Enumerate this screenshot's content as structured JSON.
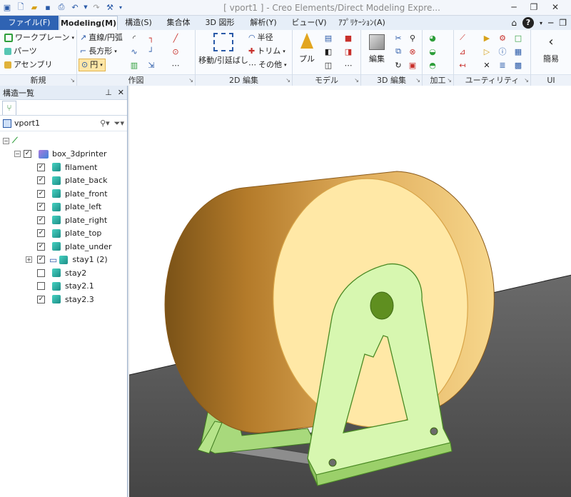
{
  "window": {
    "title": "[ vport1 ] - Creo Elements/Direct Modeling Expre..."
  },
  "tabs": [
    {
      "label": "ファイル(F)"
    },
    {
      "label": "Modeling(M)"
    },
    {
      "label": "構造(S)"
    },
    {
      "label": "集合体"
    },
    {
      "label": "3D 図形"
    },
    {
      "label": "解析(Y)"
    },
    {
      "label": "ビュー(V)"
    },
    {
      "label": "ｱﾌﾟﾘｹｰｼｮﾝ(A)"
    }
  ],
  "ribbon": {
    "new_group": {
      "label": "新規",
      "items": [
        "ワークプレーン",
        "パーツ",
        "アセンブリ"
      ]
    },
    "draw_group": {
      "label": "作図",
      "items": [
        "直線/円弧",
        "長方形",
        "円"
      ]
    },
    "edit2d_group": {
      "label": "2D 編集",
      "move_label": "移動/引延ばし",
      "items": [
        "半径",
        "トリム",
        "その他"
      ]
    },
    "model_group": {
      "label": "モデル",
      "pull_label": "プル"
    },
    "edit3d_group": {
      "label": "3D 編集",
      "edit_label": "編集"
    },
    "process_group": {
      "label": "加工"
    },
    "utility_group": {
      "label": "ユーティリティ"
    },
    "ui_group": {
      "label": "UI",
      "simple_label": "簡易"
    }
  },
  "structure_panel": {
    "title": "構造一覧",
    "viewport_name": "vport1",
    "root": {
      "label": "box_3dprinter",
      "checked": true
    },
    "items": [
      {
        "label": "filament",
        "checked": true
      },
      {
        "label": "plate_back",
        "checked": true
      },
      {
        "label": "plate_front",
        "checked": true
      },
      {
        "label": "plate_left",
        "checked": true
      },
      {
        "label": "plate_right",
        "checked": true
      },
      {
        "label": "plate_top",
        "checked": true
      },
      {
        "label": "plate_under",
        "checked": true
      },
      {
        "label": "stay1 (2)",
        "checked": true
      },
      {
        "label": "stay2",
        "checked": false
      },
      {
        "label": "stay2.1",
        "checked": false
      },
      {
        "label": "stay2.3",
        "checked": true
      }
    ]
  },
  "colors": {
    "file_tab": "#2f63b3",
    "ground": "#555555",
    "spool_side": "#b07a2b",
    "spool_face": "#ffe9a8",
    "stand": "#c8f0a0"
  }
}
